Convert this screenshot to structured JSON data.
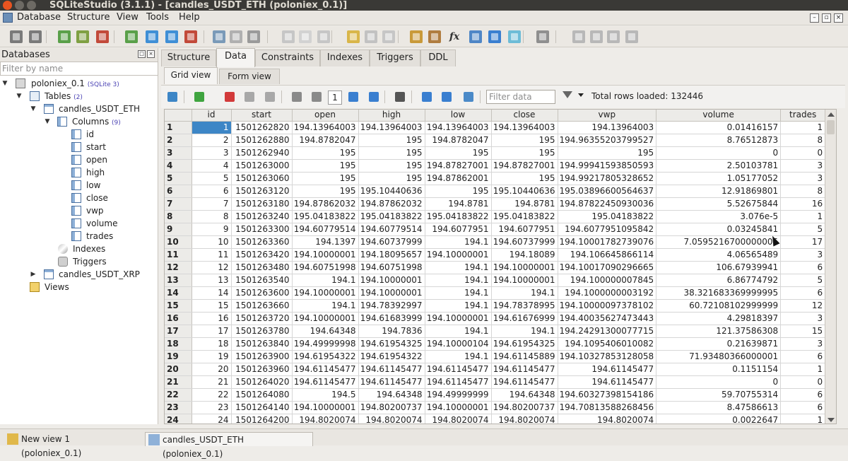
{
  "window": {
    "title": "SQLiteStudio (3.1.1) - [candles_USDT_ETH (poloniex_0.1)]"
  },
  "menu": [
    "Database",
    "Structure",
    "View",
    "Tools",
    "Help"
  ],
  "toolbar": {
    "icons": [
      "connect-icon",
      "disconnect-icon",
      "add-database-icon",
      "edit-database-icon",
      "delete-database-icon",
      "refresh-icon",
      "create-table-icon",
      "edit-table-icon",
      "delete-table-icon",
      "create-index-icon",
      "edit-index-icon",
      "delete-index-icon",
      "create-trigger-icon",
      "edit-trigger-icon",
      "delete-trigger-icon",
      "create-view-icon",
      "edit-view-icon",
      "delete-view-icon",
      "sql-editor-icon",
      "ddl-history-icon",
      "function-editor-icon",
      "collations-icon",
      "extensions-icon",
      "import-export-icon",
      "config-icon",
      "tile-icon",
      "tile-horizontal-icon",
      "tile-vertical-icon",
      "cascade-icon"
    ],
    "colors": [
      "#7a7a7a",
      "#7a7a7a",
      "#5aa04a",
      "#7fa043",
      "#c24a3a",
      "#5aa04a",
      "#3f8fd6",
      "#3f8fd6",
      "#c24a3a",
      "#7a9ab8",
      "#b0b0b0",
      "#9a9a9a",
      "#c6c6c6",
      "#d2d2d2",
      "#c6c6c6",
      "#d9b64a",
      "#c2c2c2",
      "#c6c6c6",
      "#c99a3a",
      "#b07d40",
      "",
      "#4f86c6",
      "#3a7fd0",
      "#6dbcd7",
      "#8f8f8f",
      "#b8b8b8",
      "#b8b8b8",
      "#b8b8b8",
      "#b8b8b8"
    ],
    "fx_label": "fx"
  },
  "left": {
    "header": "Databases",
    "filter_placeholder": "Filter by name",
    "database": {
      "name": "poloniex_0.1",
      "tag": "(SQLite 3)"
    },
    "tables_label": "Tables",
    "tables_count": "(2)",
    "table1": "candles_USDT_ETH",
    "columns_label": "Columns",
    "columns_count": "(9)",
    "columns": [
      "id",
      "start",
      "open",
      "high",
      "low",
      "close",
      "vwp",
      "volume",
      "trades"
    ],
    "indexes_label": "Indexes",
    "triggers_label": "Triggers",
    "table2": "candles_USDT_XRP",
    "views_label": "Views"
  },
  "tabs": [
    "Structure",
    "Data",
    "Constraints",
    "Indexes",
    "Triggers",
    "DDL"
  ],
  "active_tab": "Data",
  "subtabs": [
    "Grid view",
    "Form view"
  ],
  "active_subtab": "Grid view",
  "grid_toolbar": {
    "page": "1",
    "filter_placeholder": "Filter data",
    "rows_loaded": "Total rows loaded: 132446",
    "colors": [
      "#3d86c6",
      "#3fa43f",
      "#d23a3a",
      "#a8a8a8",
      "#a8a8a8",
      "#8a8a8a",
      "#8a8a8a",
      "#3a7fd0",
      "#3a7fd0",
      "#555555",
      "#3a7fd0",
      "#3a7fd0",
      "#4b8ac8"
    ]
  },
  "grid": {
    "columns": [
      "id",
      "start",
      "open",
      "high",
      "low",
      "close",
      "vwp",
      "volume",
      "trades"
    ],
    "rows": [
      [
        "1",
        "1",
        "1501262820",
        "194.13964003",
        "194.13964003",
        "194.13964003",
        "194.13964003",
        "194.13964003",
        "0.01416157",
        "1"
      ],
      [
        "2",
        "2",
        "1501262880",
        "194.8782047",
        "195",
        "194.8782047",
        "195",
        "194.96355203799527",
        "8.76512873",
        "8"
      ],
      [
        "3",
        "3",
        "1501262940",
        "195",
        "195",
        "195",
        "195",
        "195",
        "0",
        "0"
      ],
      [
        "4",
        "4",
        "1501263000",
        "195",
        "195",
        "194.87827001",
        "194.87827001",
        "194.99941593850593",
        "2.50103781",
        "3"
      ],
      [
        "5",
        "5",
        "1501263060",
        "195",
        "195",
        "194.87862001",
        "195",
        "194.99217805328652",
        "1.05177052",
        "3"
      ],
      [
        "6",
        "6",
        "1501263120",
        "195",
        "195.10440636",
        "195",
        "195.10440636",
        "195.03896600564637",
        "12.91869801",
        "8"
      ],
      [
        "7",
        "7",
        "1501263180",
        "194.87862032",
        "194.87862032",
        "194.8781",
        "194.8781",
        "194.87822450930036",
        "5.52675844",
        "16"
      ],
      [
        "8",
        "8",
        "1501263240",
        "195.04183822",
        "195.04183822",
        "195.04183822",
        "195.04183822",
        "195.04183822",
        "3.076e-5",
        "1"
      ],
      [
        "9",
        "9",
        "1501263300",
        "194.60779514",
        "194.60779514",
        "194.6077951",
        "194.6077951",
        "194.6077951095842",
        "0.03245841",
        "5"
      ],
      [
        "10",
        "10",
        "1501263360",
        "194.1397",
        "194.60737999",
        "194.1",
        "194.60737999",
        "194.10001782739076",
        "7.0595216700000005",
        "17"
      ],
      [
        "11",
        "11",
        "1501263420",
        "194.10000001",
        "194.18095657",
        "194.10000001",
        "194.18089",
        "194.106645866114",
        "4.06565489",
        "3"
      ],
      [
        "12",
        "12",
        "1501263480",
        "194.60751998",
        "194.60751998",
        "194.1",
        "194.10000001",
        "194.10017090296665",
        "106.67939941",
        "6"
      ],
      [
        "13",
        "13",
        "1501263540",
        "194.1",
        "194.10000001",
        "194.1",
        "194.10000001",
        "194.100000007845",
        "6.86774792",
        "5"
      ],
      [
        "14",
        "14",
        "1501263600",
        "194.10000001",
        "194.10000001",
        "194.1",
        "194.1",
        "194.1000000003192",
        "38.321683369999995",
        "6"
      ],
      [
        "15",
        "15",
        "1501263660",
        "194.1",
        "194.78392997",
        "194.1",
        "194.78378995",
        "194.10000097378102",
        "60.72108102999999",
        "12"
      ],
      [
        "16",
        "16",
        "1501263720",
        "194.10000001",
        "194.61683999",
        "194.10000001",
        "194.61676999",
        "194.40035627473443",
        "4.29818397",
        "3"
      ],
      [
        "17",
        "17",
        "1501263780",
        "194.64348",
        "194.7836",
        "194.1",
        "194.1",
        "194.24291300077715",
        "121.37586308",
        "15"
      ],
      [
        "18",
        "18",
        "1501263840",
        "194.49999998",
        "194.61954325",
        "194.10000104",
        "194.61954325",
        "194.1095406010082",
        "0.21639871",
        "3"
      ],
      [
        "19",
        "19",
        "1501263900",
        "194.61954322",
        "194.61954322",
        "194.1",
        "194.61145889",
        "194.10327853128058",
        "71.93480366000001",
        "6"
      ],
      [
        "20",
        "20",
        "1501263960",
        "194.61145477",
        "194.61145477",
        "194.61145477",
        "194.61145477",
        "194.61145477",
        "0.1151154",
        "1"
      ],
      [
        "21",
        "21",
        "1501264020",
        "194.61145477",
        "194.61145477",
        "194.61145477",
        "194.61145477",
        "194.61145477",
        "0",
        "0"
      ],
      [
        "22",
        "22",
        "1501264080",
        "194.5",
        "194.64348",
        "194.49999999",
        "194.64348",
        "194.60327398154186",
        "59.70755314",
        "6"
      ],
      [
        "23",
        "23",
        "1501264140",
        "194.10000001",
        "194.80200737",
        "194.10000001",
        "194.80200737",
        "194.70813588268456",
        "8.47586613",
        "6"
      ],
      [
        "24",
        "24",
        "1501264200",
        "194.8020074",
        "194.8020074",
        "194.8020074",
        "194.8020074",
        "194.8020074",
        "0.0022647",
        "1"
      ]
    ]
  },
  "taskbar": [
    {
      "label": "New view 1 (poloniex_0.1)",
      "color": "#e0b84a"
    },
    {
      "label": "candles_USDT_ETH (poloniex_0.1)",
      "color": "#8fb1d8"
    }
  ]
}
